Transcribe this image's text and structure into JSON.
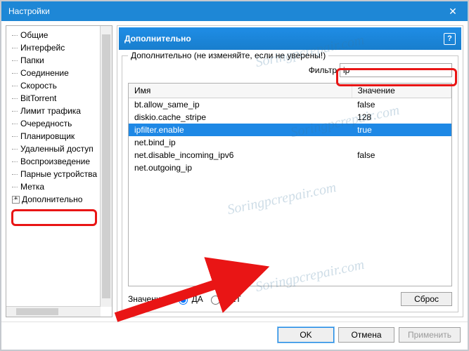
{
  "window": {
    "title": "Настройки"
  },
  "sidebar": {
    "items": [
      {
        "label": "Общие"
      },
      {
        "label": "Интерфейс"
      },
      {
        "label": "Папки"
      },
      {
        "label": "Соединение"
      },
      {
        "label": "Скорость"
      },
      {
        "label": "BitTorrent"
      },
      {
        "label": "Лимит трафика"
      },
      {
        "label": "Очередность"
      },
      {
        "label": "Планировщик"
      },
      {
        "label": "Удаленный доступ"
      },
      {
        "label": "Воспроизведение"
      },
      {
        "label": "Парные устройства"
      },
      {
        "label": "Метка"
      }
    ],
    "advanced_label": "Дополнительно"
  },
  "panel": {
    "title": "Дополнительно",
    "group_title": "Дополнительно (не изменяйте, если не уверены!)",
    "filter_label": "Фильтр",
    "filter_value": "ip",
    "columns": {
      "name": "Имя",
      "value": "Значение"
    },
    "rows": [
      {
        "name": "bt.allow_same_ip",
        "value": "false",
        "selected": false
      },
      {
        "name": "diskio.cache_stripe",
        "value": "128",
        "selected": false
      },
      {
        "name": "ipfilter.enable",
        "value": "true",
        "selected": true
      },
      {
        "name": "net.bind_ip",
        "value": "",
        "selected": false
      },
      {
        "name": "net.disable_incoming_ipv6",
        "value": "false",
        "selected": false
      },
      {
        "name": "net.outgoing_ip",
        "value": "",
        "selected": false
      }
    ],
    "value_label": "Значение:",
    "radio_yes": "ДА",
    "radio_no": "НЕТ",
    "reset_label": "Сброс"
  },
  "buttons": {
    "ok": "OK",
    "cancel": "Отмена",
    "apply": "Применить"
  },
  "watermark": "Soringpcrepair.com"
}
